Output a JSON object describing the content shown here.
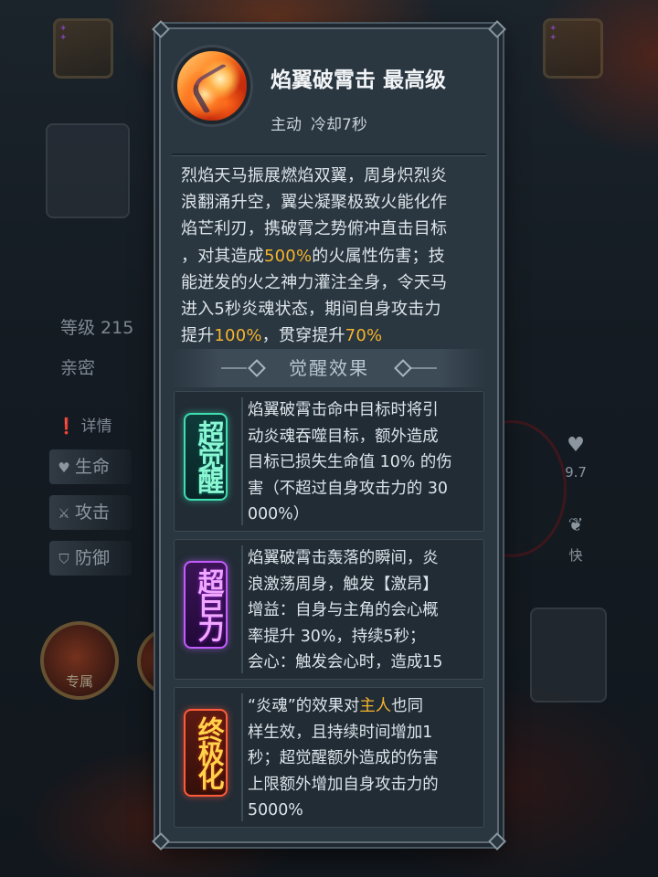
{
  "background": {
    "level_label": "等级 215",
    "intimacy_label": "亲密",
    "details_label": "详情",
    "tabs": [
      {
        "icon": "heart-icon",
        "label": "生命"
      },
      {
        "icon": "sword-icon",
        "label": "攻击"
      },
      {
        "icon": "shield-icon",
        "label": "防御"
      }
    ],
    "exclusive_label": "专属",
    "right_stat_value": "9.7",
    "right_speed_label": "快"
  },
  "skill": {
    "title": "焰翼破霄击 最高级",
    "type": "主动",
    "cooldown": "冷却7秒",
    "description_lines": [
      [
        "烈焰天马振展燃焰双翼，周身炽烈炎"
      ],
      [
        "浪翻涌升空，翼尖凝聚极致火能化作"
      ],
      [
        "焰芒利刃，携破霄之势俯冲直击目标"
      ],
      [
        "，对其造成",
        "500%",
        "的火属性伤害；技"
      ],
      [
        "能迸发的火之神力灌注全身，令天马"
      ],
      [
        "进入5秒炎魂状态，期间自身攻击力"
      ],
      [
        "提升",
        "100%",
        "，贯穿提升",
        "70%"
      ]
    ]
  },
  "awakening": {
    "title": "觉醒效果",
    "cards": [
      {
        "badge": "超觉醒",
        "lines": [
          "焰翼破霄击命中目标时将引",
          "动炎魂吞噬目标，额外造成",
          "目标已损失生命值 10% 的伤",
          "害（不超过自身攻击力的 30",
          "000%）"
        ]
      },
      {
        "badge": "超巨力",
        "lines": [
          "焰翼破霄击轰落的瞬间，炎",
          "浪激荡周身，触发【激昂】",
          "增益：自身与主角的会心概",
          "率提升 30%，持续5秒；",
          "会心：触发会心时，造成15"
        ]
      },
      {
        "badge": "终极化",
        "line1_prefix": "“炎魂”的效果对",
        "line1_highlight": "主人",
        "line1_suffix": "也同",
        "lines": [
          "样生效，且持续时间增加1",
          "秒；超觉醒额外造成的伤害",
          "上限额外增加自身攻击力的",
          "5000%"
        ]
      }
    ]
  },
  "colors": {
    "highlight": "#f6b52c",
    "panel_bg": "#2a3640",
    "super_awaken": "#3fe0b0",
    "super_giant": "#c35cff",
    "ultimate": "#ff5b3a"
  }
}
